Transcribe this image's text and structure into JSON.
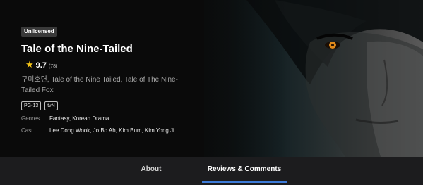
{
  "show": {
    "badge": "Unlicensed",
    "title": "Tale of the Nine-Tailed",
    "rating": "9.7",
    "rating_count": "(78)",
    "alt_titles": "구미호뎐, Tale of the Nine Tailed, Tale of The Nine-Tailed Fox",
    "tags": [
      "PG-13",
      "tvN"
    ],
    "genres_label": "Genres",
    "genres": "Fantasy, Korean Drama",
    "cast_label": "Cast",
    "cast": "Lee Dong Wook, Jo Bo Ah, Kim Bum, Kim Yong Ji"
  },
  "tabs": {
    "about": "About",
    "reviews": "Reviews & Comments",
    "active": "reviews"
  },
  "colors": {
    "accent": "#3d7bd8",
    "star": "#f5c518",
    "eye": "#e08a1a"
  },
  "icons": {
    "star": "star-icon"
  }
}
